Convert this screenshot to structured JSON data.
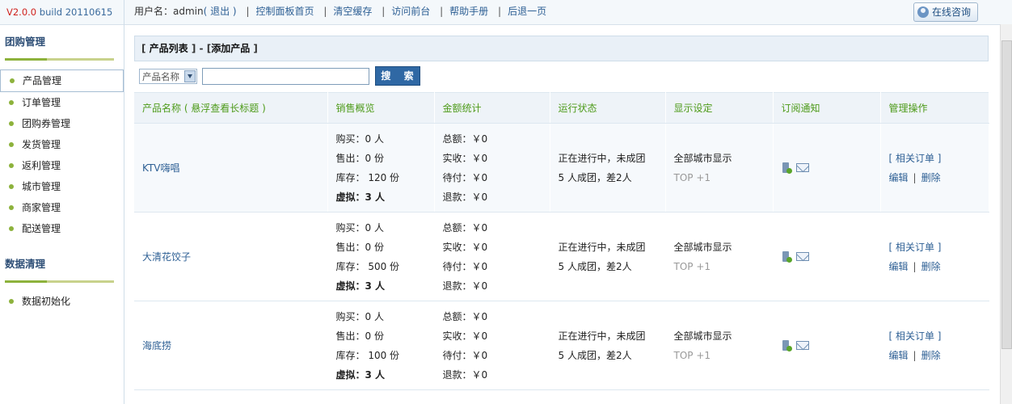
{
  "version": {
    "prefix": "V2.0.0",
    "build": "build 20110615"
  },
  "topbar": {
    "user_label": "用户名：",
    "username": "admin",
    "logout": "( 退出 )",
    "links": [
      "控制面板首页",
      "清空缓存",
      "访问前台",
      "帮助手册",
      "后退一页"
    ],
    "online_btn": "在线咨询"
  },
  "sidebar": {
    "sections": [
      {
        "title": "团购管理",
        "items": [
          "产品管理",
          "订单管理",
          "团购券管理",
          "发货管理",
          "返利管理",
          "城市管理",
          "商家管理",
          "配送管理"
        ]
      },
      {
        "title": "数据清理",
        "items": [
          "数据初始化"
        ]
      }
    ]
  },
  "crumb": {
    "list": "产品列表",
    "add": "添加产品"
  },
  "search": {
    "select_value": "产品名称",
    "input_value": "",
    "button": "搜 索"
  },
  "table": {
    "headers": [
      "产品名称 ( 悬浮查看长标题 )",
      "销售概览",
      "金额统计",
      "运行状态",
      "显示设定",
      "订阅通知",
      "管理操作"
    ],
    "rows": [
      {
        "name": "KTV嗨唱",
        "sales": [
          "购买：0 人",
          "售出：0 份",
          "库存：  120 份",
          "虚拟：3 人"
        ],
        "money": [
          "总额：￥0",
          "实收：￥0",
          "待付：￥0",
          "退款：￥0"
        ],
        "status": [
          "正在进行中，未成团",
          "5 人成团，差2人"
        ],
        "display": [
          "全部城市显示",
          "TOP +1"
        ],
        "ops": {
          "orders": "[ 相关订单 ]",
          "edit": "编辑",
          "delete": "删除"
        }
      },
      {
        "name": "大清花饺子",
        "sales": [
          "购买：0 人",
          "售出：0 份",
          "库存：  500 份",
          "虚拟：3 人"
        ],
        "money": [
          "总额：￥0",
          "实收：￥0",
          "待付：￥0",
          "退款：￥0"
        ],
        "status": [
          "正在进行中，未成团",
          "5 人成团，差2人"
        ],
        "display": [
          "全部城市显示",
          "TOP +1"
        ],
        "ops": {
          "orders": "[ 相关订单 ]",
          "edit": "编辑",
          "delete": "删除"
        }
      },
      {
        "name": "海底捞",
        "sales": [
          "购买：0 人",
          "售出：0 份",
          "库存：   100 份",
          "虚拟：3 人"
        ],
        "money": [
          "总额：￥0",
          "实收：￥0",
          "待付：￥0",
          "退款：￥0"
        ],
        "status": [
          "正在进行中，未成团",
          "5 人成团，差2人"
        ],
        "display": [
          "全部城市显示",
          "TOP +1"
        ],
        "ops": {
          "orders": "[ 相关订单 ]",
          "edit": "编辑",
          "delete": "删除"
        }
      }
    ]
  }
}
